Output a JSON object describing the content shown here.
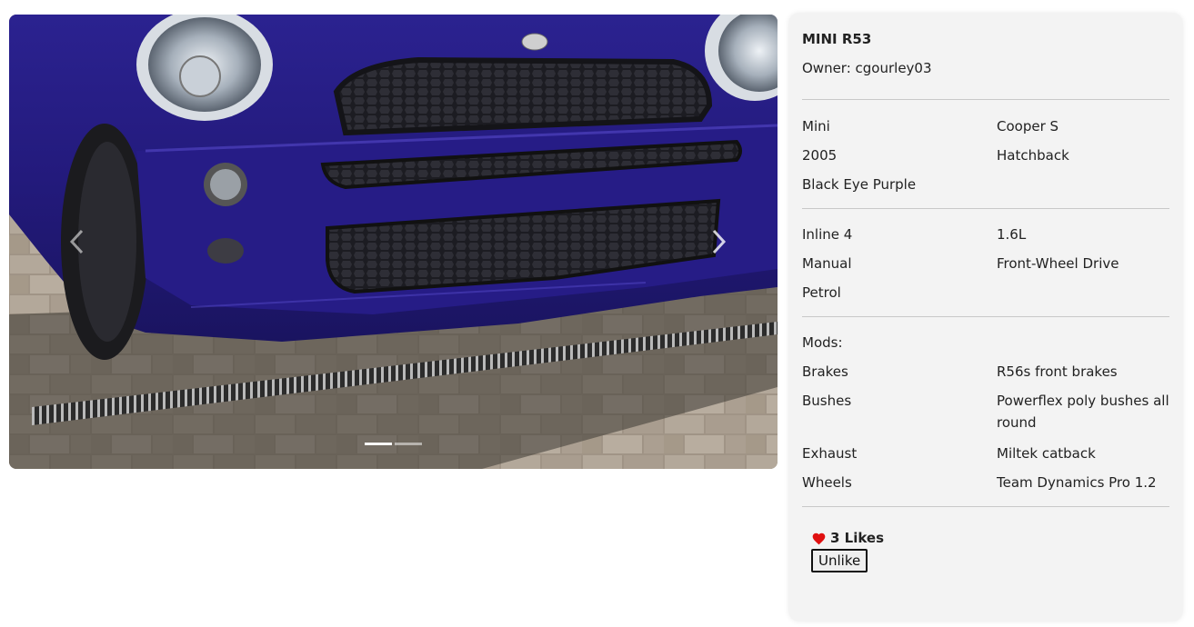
{
  "car": {
    "title": "MINI R53",
    "owner": "Owner: cgourley03"
  },
  "specs": {
    "make": "Mini",
    "trim": "Cooper S",
    "year": "2005",
    "body": "Hatchback",
    "color": "Black Eye Purple",
    "engine": "Inline 4",
    "displacement": "1.6L",
    "transmission": "Manual",
    "drivetrain": "Front-Wheel Drive",
    "fuel": "Petrol"
  },
  "mods": {
    "heading": "Mods:",
    "items": [
      {
        "name": "Brakes",
        "value": "R56s front brakes"
      },
      {
        "name": "Bushes",
        "value": "Powerflex poly bushes all round"
      },
      {
        "name": "Exhaust",
        "value": "Miltek catback"
      },
      {
        "name": "Wheels",
        "value": "Team Dynamics Pro 1.2"
      }
    ]
  },
  "likes": {
    "count_label": "3 Likes",
    "button_label": "Unlike",
    "heart_color": "#e01010"
  },
  "carousel": {
    "prev_icon": "chevron-left-icon",
    "next_icon": "chevron-right-icon",
    "slide_count": 2,
    "active_slide": 1,
    "car_color": "#2a1f8a"
  }
}
